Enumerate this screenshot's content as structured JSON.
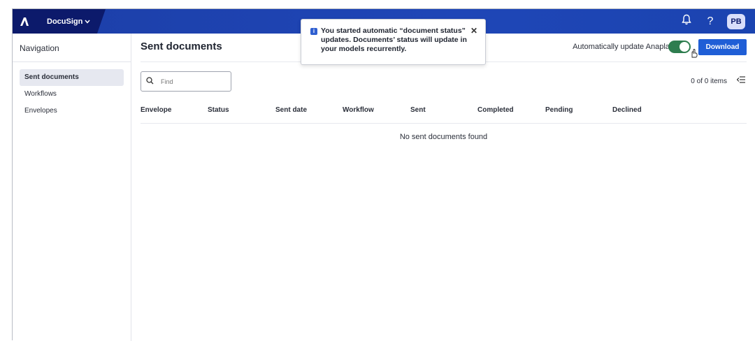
{
  "topbar": {
    "app_name": "DocuSign",
    "chevron": "⌄",
    "logo_glyph": "A",
    "bell_icon": "bell-icon",
    "help_label": "?",
    "avatar_initials": "PB"
  },
  "sidebar": {
    "title": "Navigation",
    "items": [
      {
        "label": "Sent documents",
        "active": true
      },
      {
        "label": "Workflows",
        "active": false
      },
      {
        "label": "Envelopes",
        "active": false
      }
    ]
  },
  "main": {
    "page_title": "Sent documents",
    "auto_update_label": "Automatically update Anaplan",
    "auto_update_on": true,
    "download_label": "Download",
    "search_placeholder": "Find",
    "item_count": "0 of 0 items",
    "columns": [
      "Envelope",
      "Status",
      "Sent date",
      "Workflow",
      "Sent",
      "Completed",
      "Pending",
      "Declined"
    ],
    "empty_message": "No sent documents found"
  },
  "toast": {
    "message": "You started automatic “document status” updates. Documents’ status will update in your models recurrently.",
    "close_label": "✕"
  },
  "colors": {
    "topbar": "#1f46b7",
    "topbar_dark": "#0c1a6b",
    "accent_button": "#1f5ed6",
    "toggle_on": "#2e7d4f"
  }
}
